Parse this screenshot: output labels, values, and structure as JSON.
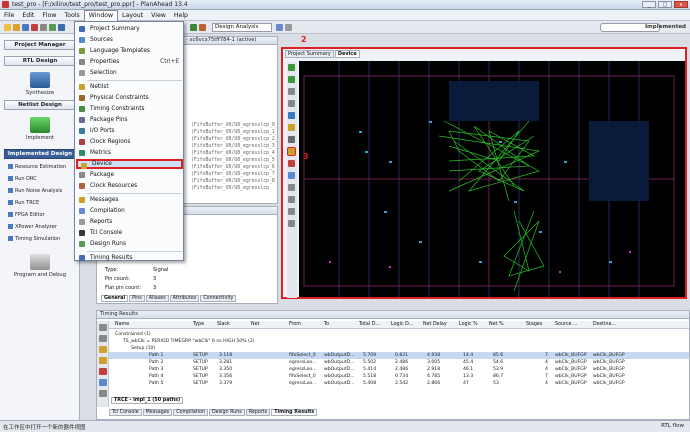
{
  "window": {
    "title": "test_pro - [F:/xilinx/test_pro/test_pro.ppr] - PlanAhead 13.4",
    "min": "_",
    "max": "□",
    "close": "x"
  },
  "menubar": [
    "File",
    "Edit",
    "Flow",
    "Tools",
    "Window",
    "Layout",
    "View",
    "Help"
  ],
  "toolbar": {
    "layout_select": "Design Analysis",
    "status": "Implemented"
  },
  "flow_navigator": {
    "sections": [
      {
        "label": "Project Manager"
      },
      {
        "label": "RTL Design"
      },
      {
        "label": "Synthesize"
      },
      {
        "label": "Netlist Design"
      },
      {
        "label": "Implement"
      },
      {
        "label": "Implemented Design"
      }
    ],
    "implemented_items": [
      "Resource Estimation",
      "Run DRC",
      "Run Noise Analysis",
      "Run TRCE",
      "FPGA Editor",
      "XPower Analyzer",
      "Timing Simulation"
    ],
    "program_debug": "Program and Debug"
  },
  "netlist_panel": {
    "title": "- xc6vcx75tff784-1 (active)",
    "lines": [
      "(FifoBuffer_U0/U8_egresslcp_0_",
      "(FifoBuffer_U0/U8_egresslcp_1_",
      "(FifoBuffer_U0/U8_egresslcp_2_",
      "(FifoBuffer_U0/U8_egresslcp_3_",
      "(FifoBuffer_U0/U8_egresslcp_4",
      "(FifoBuffer_U0/U8_egresslcp_5",
      "(FifoBuffer_U0/U8_egresslcp_6",
      "(FifoBuffer_U0/U8_egresslcp_7",
      "(FifoBuffer_U0/U8_egresslcp_8",
      "(FifoBuffer_U0/U8_egresslcp"
    ]
  },
  "properties_panel": {
    "type_label": "Type:",
    "type_value": "Signal",
    "pin_count_label": "Pin count:",
    "pin_count_value": "3",
    "flat_pin_label": "Flat pin count:",
    "flat_pin_value": "3",
    "tabs": [
      "General",
      "Pins",
      "Aliases",
      "Attributes",
      "Connectivity"
    ]
  },
  "window_menu": [
    {
      "label": "Project Summary",
      "icon": "summary-icon",
      "color": "#3c6bb8"
    },
    {
      "label": "Sources",
      "icon": "sources-icon",
      "color": "#5a8ad0"
    },
    {
      "label": "Language Templates",
      "icon": "templates-icon",
      "color": "#7a9a3a"
    },
    {
      "label": "Properties",
      "icon": "properties-icon",
      "color": "#888888",
      "shortcut": "Ctrl+E"
    },
    {
      "label": "Selection",
      "icon": "selection-icon",
      "color": "#999999"
    },
    {
      "label": "Netlist",
      "icon": "netlist-icon",
      "color": "#c9a227",
      "sep_before": true
    },
    {
      "label": "Physical Constraints",
      "icon": "physical-icon",
      "color": "#9a6a2a"
    },
    {
      "label": "Timing Constraints",
      "icon": "timing-icon",
      "color": "#4a8a4a"
    },
    {
      "label": "Package Pins",
      "icon": "pins-icon",
      "color": "#6a6a9a"
    },
    {
      "label": "I/O Ports",
      "icon": "ports-icon",
      "color": "#3a7a9a"
    },
    {
      "label": "Clock Regions",
      "icon": "clock-icon",
      "color": "#aa4444"
    },
    {
      "label": "Metrics",
      "icon": "metrics-icon",
      "color": "#2a8a6a"
    },
    {
      "label": "Device",
      "icon": "device-icon",
      "color": "#c9a227",
      "highlight": true
    },
    {
      "label": "Package",
      "icon": "package-icon",
      "color": "#8a8a8a"
    },
    {
      "label": "Clock Resources",
      "icon": "clock-resources-icon",
      "color": "#aa6644"
    },
    {
      "label": "Messages",
      "icon": "messages-icon",
      "color": "#d09a2a",
      "sep_before": true
    },
    {
      "label": "Compilation",
      "icon": "compilation-icon",
      "color": "#6a8ad0"
    },
    {
      "label": "Reports",
      "icon": "reports-icon",
      "color": "#9a9a9a"
    },
    {
      "label": "Tcl Console",
      "icon": "console-icon",
      "color": "#3a3a3a"
    },
    {
      "label": "Design Runs",
      "icon": "runs-icon",
      "color": "#5a9a5a"
    },
    {
      "label": "Timing Results",
      "icon": "timing-results-icon",
      "color": "#4a6ab0",
      "sep_before": true
    }
  ],
  "device_view": {
    "tabs": [
      "Project Summary",
      "Device"
    ],
    "marker_2": "2",
    "marker_3": "3"
  },
  "timing_results": {
    "title": "Timing Results",
    "columns": [
      "Name",
      "Type",
      "Slack",
      "Net",
      "From",
      "To",
      "Total D...",
      "Logic D...",
      "Net Delay",
      "Logic %",
      "Net %",
      "Stages",
      "Source ...",
      "Destina..."
    ],
    "tree": [
      "Constrained (1)",
      "TS_wbClk = PERIOD TIMEGRP \"wbClk\" 6 ns HIGH 50% (2)",
      "Setup (10)"
    ],
    "rows": [
      [
        "Path 1",
        "SETUP",
        "3.118",
        "",
        "fifoSelect_0",
        "wbOutputD...",
        "5.709",
        "0.831",
        "4.938",
        "14.4",
        "85.6",
        "7",
        "wbClk_BUFGP",
        "wbClk_BUFGP"
      ],
      [
        "Path 2",
        "SETUP",
        "3.281",
        "",
        "egressLoo...",
        "wbOutputD...",
        "5.502",
        "2.486",
        "3.005",
        "45.4",
        "54.6",
        "4",
        "wbClk_BUFGP",
        "wbClk_BUFGP"
      ],
      [
        "Path 3",
        "SETUP",
        "3.350",
        "",
        "egressLoo...",
        "wbOutputD...",
        "5.414",
        "2.486",
        "2.918",
        "46.1",
        "53.9",
        "4",
        "wbClk_BUFGP",
        "wbClk_BUFGP"
      ],
      [
        "Path 4",
        "SETUP",
        "3.356",
        "",
        "fifoSelect_0",
        "wbOutputD...",
        "5.518",
        "0.734",
        "4.785",
        "13.3",
        "86.7",
        "7",
        "wbClk_BUFGP",
        "wbClk_BUFGP"
      ],
      [
        "Path 5",
        "SETUP",
        "3.379",
        "",
        "egressLoo...",
        "wbOutputD...",
        "5.408",
        "2.542",
        "2.866",
        "47",
        "53",
        "4",
        "wbClk_BUFGP",
        "wbClk_BUFGP"
      ]
    ],
    "trce_tab": "TRCE - impl_1 (50 paths)",
    "bottom_tabs": [
      "Tcl Console",
      "Messages",
      "Compilation",
      "Design Runs",
      "Reports",
      "Timing Results"
    ]
  },
  "statusbar": {
    "left": "在工作区中打开一个新的器件视图",
    "right": "RTL flow"
  }
}
